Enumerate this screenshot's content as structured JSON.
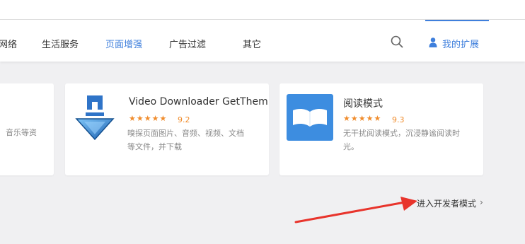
{
  "nav": {
    "items": [
      {
        "label": "网络",
        "active": false
      },
      {
        "label": "生活服务",
        "active": false
      },
      {
        "label": "页面增强",
        "active": true
      },
      {
        "label": "广告过滤",
        "active": false
      },
      {
        "label": "其它",
        "active": false
      }
    ],
    "search_icon": "search-icon",
    "my_extensions": {
      "label": "我的扩展",
      "icon": "person-icon"
    }
  },
  "cards": [
    {
      "title": "",
      "stars": "",
      "score": "",
      "desc_line1": "",
      "desc_line2": "音乐等资"
    },
    {
      "title": "Video Downloader GetThem...",
      "stars": "★★★★★",
      "rating": 4.5,
      "score": "9.2",
      "desc_line1": "嗅探页面图片、音频、视频、文档",
      "desc_line2": "等文件，并下载",
      "icon": "download-arrow-icon"
    },
    {
      "title": "阅读模式",
      "stars": "★★★★★",
      "rating": 5,
      "score": "9.3",
      "desc_line1": "无干扰阅读模式，沉浸静谧阅读时",
      "desc_line2": "光。",
      "icon": "open-book-icon"
    }
  ],
  "developer_mode": {
    "label": "进入开发者模式",
    "chevron": "›"
  },
  "colors": {
    "accent": "#3f7fdc",
    "star": "#f08c2c",
    "annotation_arrow": "#e8342c",
    "book_tile": "#3d8de0"
  }
}
